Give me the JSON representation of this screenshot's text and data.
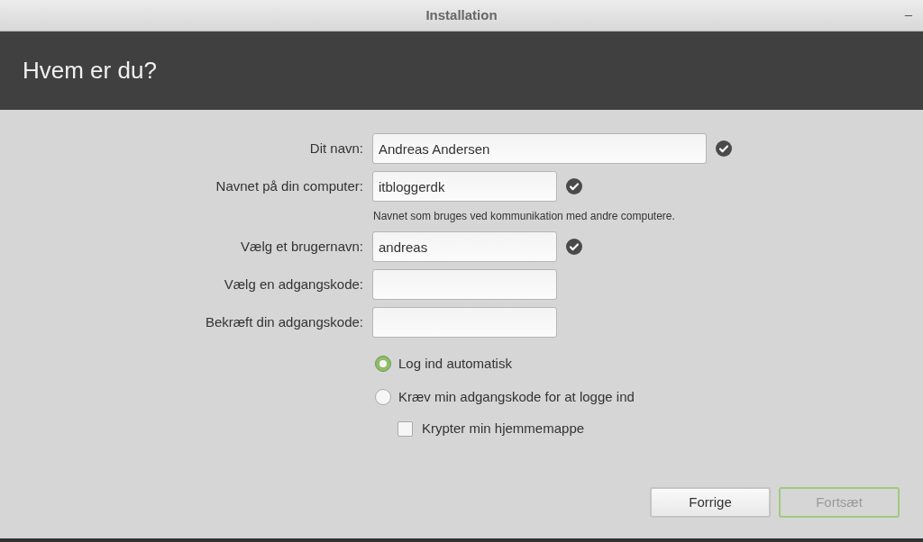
{
  "window": {
    "title": "Installation",
    "minimize": "–"
  },
  "header": {
    "title": "Hvem er du?"
  },
  "fields": [
    {
      "label": "Dit navn:",
      "value": "Andreas Andersen",
      "valid": true
    },
    {
      "label": "Navnet på din computer:",
      "value": "itbloggerdk",
      "valid": true,
      "hint": "Navnet som bruges ved kommunikation med andre computere."
    },
    {
      "label": "Vælg et brugernavn:",
      "value": "andreas",
      "valid": true
    },
    {
      "label": "Vælg en adgangskode:",
      "valid": false
    },
    {
      "label": "Bekræft din adgangskode:",
      "valid": false
    }
  ],
  "login_options": [
    {
      "label": "Log ind automatisk",
      "selected": true
    },
    {
      "label": "Kræv min adgangskode for at logge ind",
      "selected": false
    }
  ],
  "encrypt": {
    "label": "Krypter min hjemmemappe",
    "checked": false
  },
  "buttons": [
    {
      "label": "Forrige",
      "kind": "normal",
      "disabled": false
    },
    {
      "label": "Fortsæt",
      "kind": "default",
      "disabled": true
    }
  ]
}
